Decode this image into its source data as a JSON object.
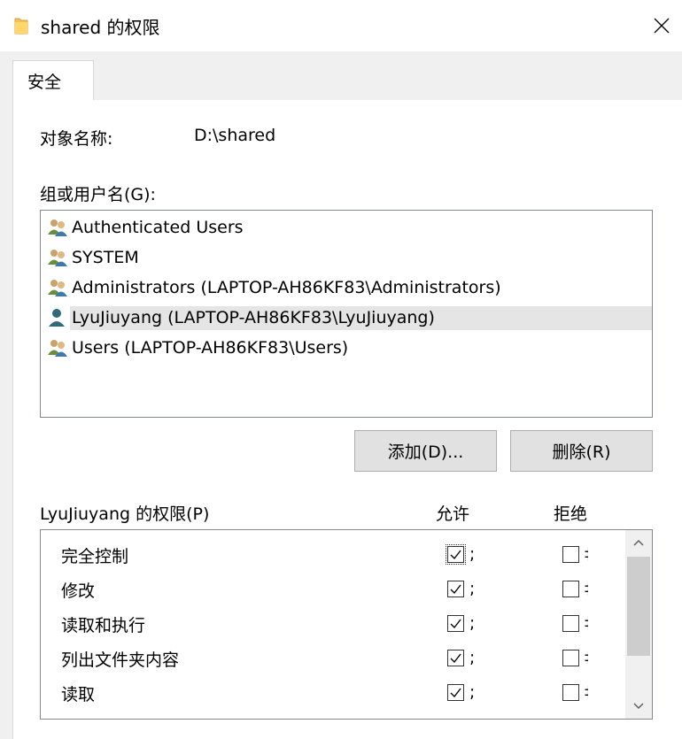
{
  "window": {
    "title": "shared 的权限",
    "icon": "folder-icon",
    "close_icon": "close-icon"
  },
  "tabs": [
    {
      "label": "安全",
      "active": true
    }
  ],
  "object": {
    "label": "对象名称:",
    "value": "D:\\shared"
  },
  "groups": {
    "label": "组或用户名(G):",
    "items": [
      {
        "name": "Authenticated Users",
        "icon": "group-icon",
        "selected": false
      },
      {
        "name": "SYSTEM",
        "icon": "group-icon",
        "selected": false
      },
      {
        "name": "Administrators (LAPTOP-AH86KF83\\Administrators)",
        "icon": "group-icon",
        "selected": false
      },
      {
        "name": "LyuJiuyang (LAPTOP-AH86KF83\\LyuJiuyang)",
        "icon": "user-icon",
        "selected": true
      },
      {
        "name": "Users (LAPTOP-AH86KF83\\Users)",
        "icon": "group-icon",
        "selected": false
      }
    ]
  },
  "buttons": {
    "add": "添加(D)...",
    "remove": "删除(R)"
  },
  "permissions": {
    "label": "LyuJiuyang 的权限(P)",
    "allow_header": "允许",
    "deny_header": "拒绝",
    "items": [
      {
        "name": "完全控制",
        "allow": true,
        "deny": false
      },
      {
        "name": "修改",
        "allow": true,
        "deny": false
      },
      {
        "name": "读取和执行",
        "allow": true,
        "deny": false
      },
      {
        "name": "列出文件夹内容",
        "allow": true,
        "deny": false
      },
      {
        "name": "读取",
        "allow": true,
        "deny": false
      }
    ]
  },
  "colors": {
    "selection": "#e5e5e5",
    "dialog_bg": "#f0f0f0",
    "button_bg": "#e1e1e1",
    "folder": "#f5c15c"
  }
}
